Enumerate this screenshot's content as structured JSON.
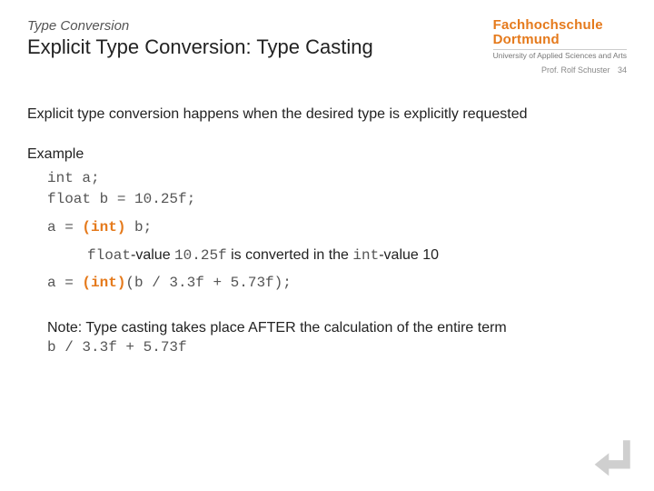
{
  "header": {
    "overtitle": "Type Conversion",
    "title": "Explicit Type Conversion: Type Casting"
  },
  "logo": {
    "line1": "Fachhochschule",
    "line2": "Dortmund",
    "sub": "University of Applied Sciences and Arts"
  },
  "meta": {
    "author": "Prof. Rolf Schuster",
    "page": "34"
  },
  "body": {
    "intro": "Explicit type conversion happens when the desired type is explicitly requested",
    "example_label": "Example",
    "code": {
      "l1": "int a;",
      "l2": "float b = 10.25f;",
      "l3_a": "a = ",
      "l3_cast": "(int)",
      "l3_b": " b;",
      "l4_a": "a = ",
      "l4_cast": "(int)",
      "l4_b": "(b / 3.3f + 5.73f);"
    },
    "explain": {
      "t1": "float",
      "t2": "-value ",
      "t3": "10.25f",
      "t4": " is converted in the ",
      "t5": "int",
      "t6": "-value 10"
    },
    "note": {
      "line1": "Note: Type casting takes place AFTER the calculation of the entire term",
      "term": "b / 3.3f + 5.73f"
    }
  }
}
